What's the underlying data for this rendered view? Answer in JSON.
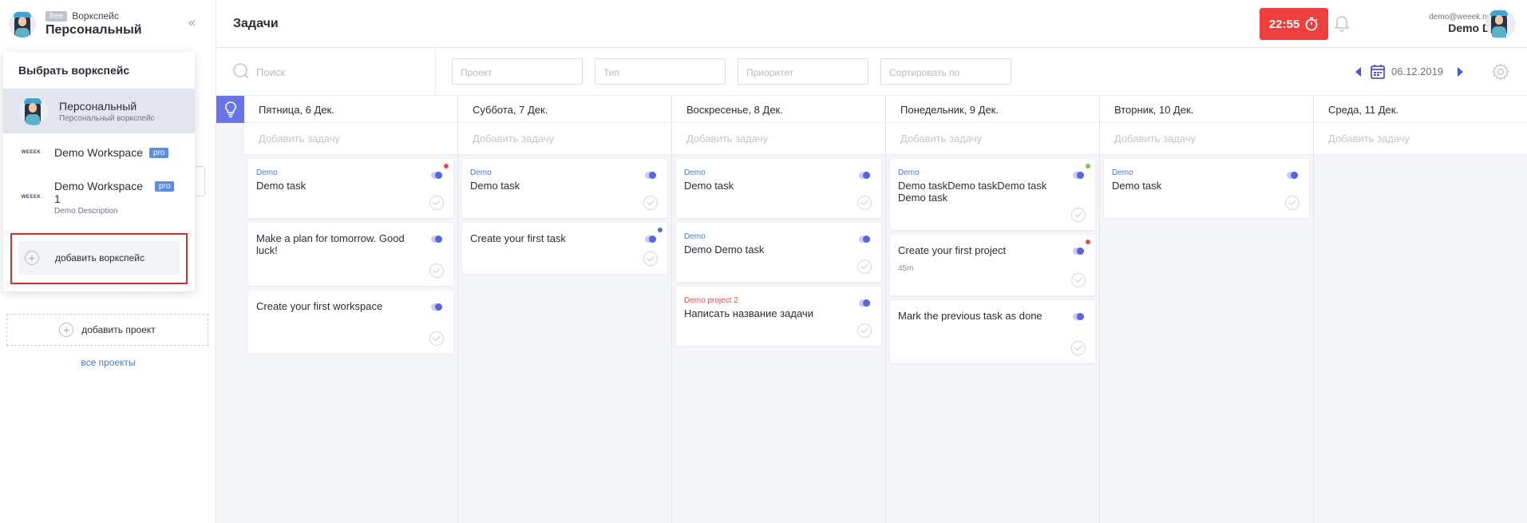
{
  "workspace": {
    "badge": "free",
    "label": "Воркспейс",
    "name": "Персональный"
  },
  "dropdown": {
    "title": "Выбрать воркспейс",
    "items": [
      {
        "name": "Персональный",
        "sub": "Персональный воркспейс",
        "pro": ""
      },
      {
        "name": "Demo Workspace",
        "sub": "",
        "pro": "pro"
      },
      {
        "name": "Demo Workspace 1",
        "sub": "Demo Description",
        "pro": "pro"
      }
    ],
    "add_label": "добавить воркспейс",
    "logo_text": "WEEEK"
  },
  "sidebar": {
    "add_project": "добавить проект",
    "all_projects": "все проекты"
  },
  "header": {
    "title": "Задачи",
    "timer": "22:55",
    "user_email": "demo@weeek.net",
    "user_name": "Demo D."
  },
  "filters": {
    "search_placeholder": "Поиск",
    "project": "Проект",
    "type": "Тип",
    "priority": "Приоритет",
    "sort": "Сортировать по",
    "date": "06.12.2019"
  },
  "add_task_label": "Добавить задачу",
  "colors": {
    "accent": "#5a64e0",
    "timer": "#ef3e3e",
    "link": "#4a77d4",
    "priority_red": "#ef4747",
    "priority_blue": "#4a77d4",
    "priority_green": "#7bc54a"
  },
  "columns": [
    {
      "day": "Пятница, 6 Дек.",
      "cards": [
        {
          "project": "Demo",
          "title": "Demo task",
          "priority": "red"
        },
        {
          "project": "",
          "title": "Make a plan for tomorrow. Good luck!",
          "priority": ""
        },
        {
          "project": "",
          "title": "Create your first workspace",
          "priority": ""
        }
      ]
    },
    {
      "day": "Суббота, 7 Дек.",
      "cards": [
        {
          "project": "Demo",
          "title": "Demo task",
          "priority": ""
        },
        {
          "project": "",
          "title": "Create your first task",
          "priority": "blue"
        }
      ]
    },
    {
      "day": "Воскресенье, 8 Дек.",
      "cards": [
        {
          "project": "Demo",
          "title": "Demo task",
          "priority": ""
        },
        {
          "project": "Demo",
          "title": "Demo Demo task",
          "priority": ""
        },
        {
          "project": "Demo project 2",
          "title": "Написать название задачи",
          "priority": "",
          "project_color": "red"
        }
      ]
    },
    {
      "day": "Понедельник, 9 Дек.",
      "cards": [
        {
          "project": "Demo",
          "title": "Demo taskDemo taskDemo task Demo task",
          "priority": "green"
        },
        {
          "project": "",
          "title": "Create your first project",
          "priority": "red",
          "time": "45m"
        },
        {
          "project": "",
          "title": "Mark the previous task as done",
          "priority": ""
        }
      ]
    },
    {
      "day": "Вторник, 10 Дек.",
      "cards": [
        {
          "project": "Demo",
          "title": "Demo task",
          "priority": ""
        }
      ]
    },
    {
      "day": "Среда, 11 Дек.",
      "cards": []
    }
  ]
}
